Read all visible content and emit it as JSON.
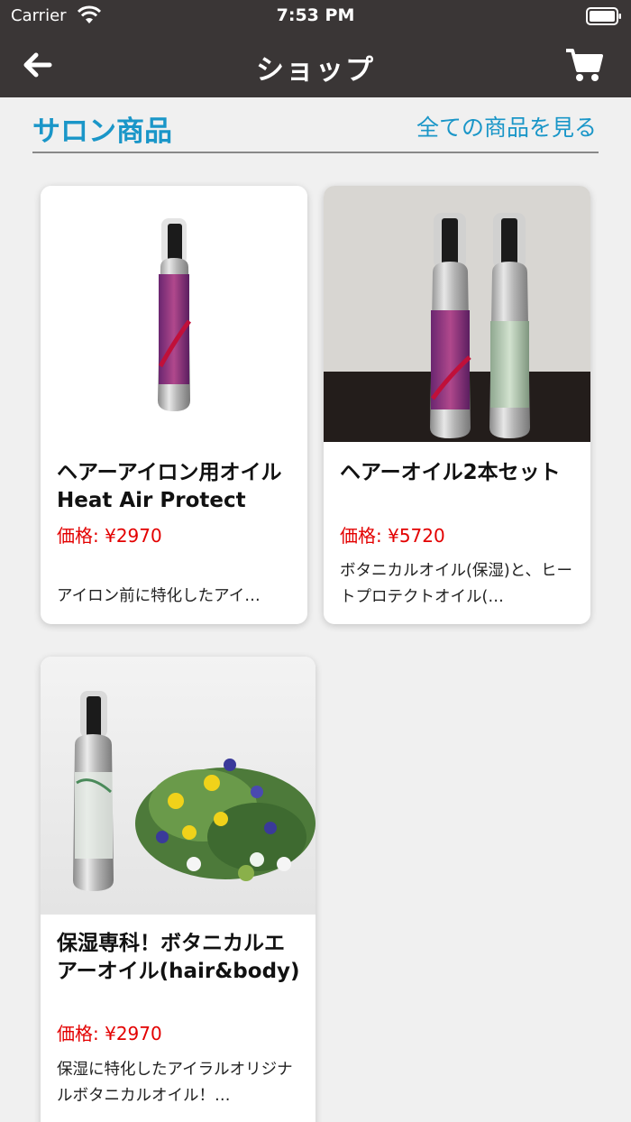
{
  "status_bar": {
    "carrier": "Carrier",
    "time": "7:53 PM"
  },
  "nav": {
    "title": "ショップ",
    "back_icon": "arrow-left-icon",
    "cart_icon": "shopping-cart-icon"
  },
  "section": {
    "title": "サロン商品",
    "see_all_label": "全ての商品を見る"
  },
  "colors": {
    "header_bg": "#3a3636",
    "accent": "#1a96c8",
    "price": "#e30000"
  },
  "products": [
    {
      "name": "ヘアーアイロン用オイル Heat Air Protect",
      "price": "価格: ¥2970",
      "description": "アイロン前に特化したアイ…"
    },
    {
      "name": "ヘアーオイル2本セット",
      "price": "価格: ¥5720",
      "description": "ボタニカルオイル(保湿)と、ヒートプロテクトオイル(…"
    },
    {
      "name": "保湿専科！ボタニカルエアーオイル(hair&body)",
      "price": "価格: ¥2970",
      "description": "保湿に特化したアイラルオリジナルボタニカルオイル！…"
    }
  ]
}
